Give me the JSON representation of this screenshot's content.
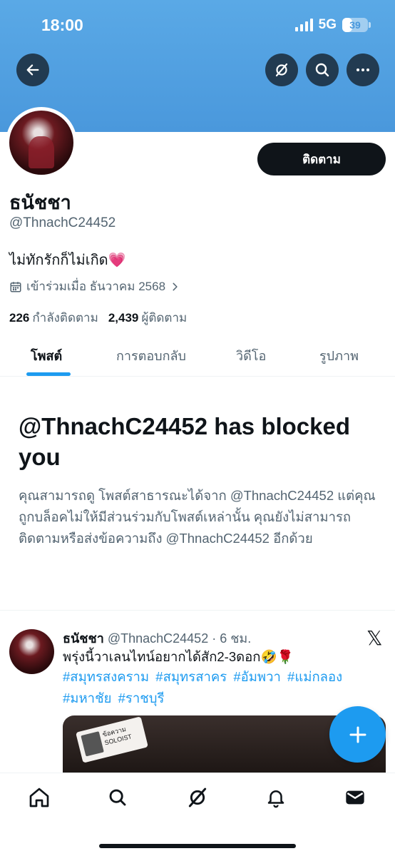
{
  "status_bar": {
    "time": "18:00",
    "network": "5G",
    "battery": "39",
    "battery_level": 0.39
  },
  "header": {
    "back_icon": "arrow-left-icon",
    "grok_icon": "grok-icon",
    "search_icon": "search-icon",
    "more_icon": "more-horizontal-icon"
  },
  "profile": {
    "follow_label": "ติดตาม",
    "display_name": "ธนัชชา",
    "handle": "@ThnachC24452",
    "bio": "ไม่ทักรักก็ไม่เกิด💗",
    "joined": "เข้าร่วมเมื่อ ธันวาคม 2568",
    "following_count": "226",
    "following_label": "กำลังติดตาม",
    "followers_count": "2,439",
    "followers_label": "ผู้ติดตาม"
  },
  "tabs": [
    {
      "label": "โพสต์",
      "active": true
    },
    {
      "label": "การตอบกลับ",
      "active": false
    },
    {
      "label": "วิดีโอ",
      "active": false
    },
    {
      "label": "รูปภาพ",
      "active": false
    }
  ],
  "blocked": {
    "title": "@ThnachC24452 has blocked you",
    "body": "คุณสามารถดู โพสต์สาธารณะได้จาก @ThnachC24452 แต่คุณถูกบล็อคไม่ให้มีส่วนร่วมกับโพสต์เหล่านั้น คุณยังไม่สามารถติดตามหรือส่งข้อความถึง @ThnachC24452 อีกด้วย"
  },
  "post": {
    "name": "ธนัชชา",
    "meta": " @ThnachC24452 · 6 ชม.",
    "text": "พรุ่งนี้วาเลนไทน์อยากได้สัก2-3ดอก🤣🌹",
    "hashtags": [
      "#สมุทรสงคราม",
      "#สมุทรสาคร",
      "#อัมพวา",
      "#แม่กลอง",
      "#มหาชัย",
      "#ราชบุรี"
    ],
    "media_sticker_line1": "ข้อความ",
    "media_sticker_line2": "SOLOIST"
  },
  "fab_label": "+",
  "bottom_nav": [
    "home-icon",
    "search-icon",
    "grok-icon",
    "notifications-icon",
    "messages-icon"
  ],
  "colors": {
    "accent": "#1d9bf0",
    "banner": "#4a98dc",
    "text": "#0f1419",
    "muted": "#536471"
  }
}
